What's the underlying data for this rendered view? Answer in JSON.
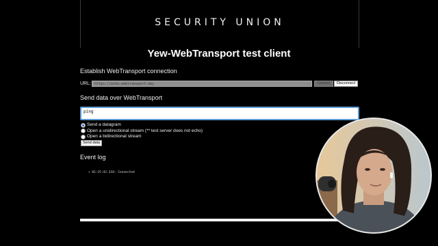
{
  "header": {
    "brand": "SECURITY UNION"
  },
  "app": {
    "title": "Yew-WebTransport test client"
  },
  "connection": {
    "section_title": "Establish WebTransport connection",
    "url_label": "URL:",
    "url_placeholder": "https://echo.webtransport.day",
    "connect_label": "Connect",
    "disconnect_label": "Disconnect"
  },
  "send": {
    "section_title": "Send data over WebTransport",
    "message_value": "ping",
    "options": [
      {
        "label": "Send a datagram",
        "checked": true
      },
      {
        "label": "Open a unidirectional stream (** test server does not echo)",
        "checked": false
      },
      {
        "label": "Open a bidirectional stream",
        "checked": false
      }
    ],
    "send_button": "Send data"
  },
  "log": {
    "section_title": "Event log",
    "entries": [
      "+ 01:25:42.334: Connected"
    ]
  }
}
